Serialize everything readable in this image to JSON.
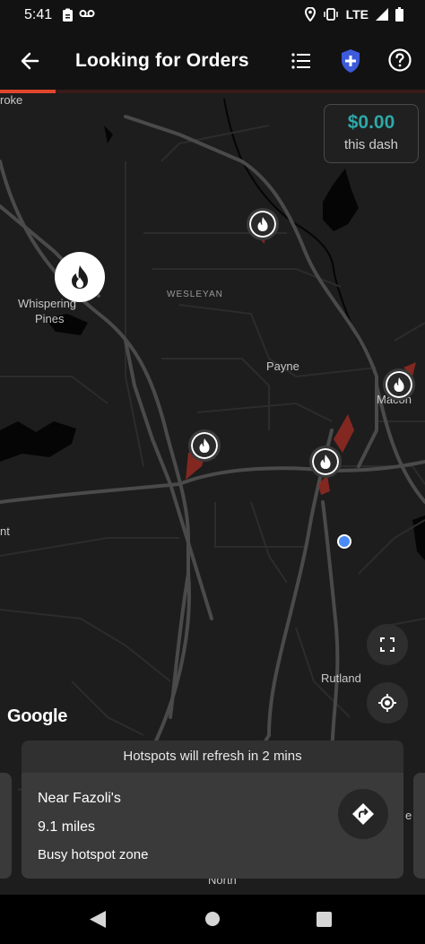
{
  "status_bar": {
    "time": "5:41",
    "network": "LTE",
    "icons": [
      "clipboard-icon",
      "voicemail-icon",
      "location-icon",
      "vibrate-icon",
      "signal-icon",
      "battery-icon"
    ]
  },
  "app_bar": {
    "title": "Looking for Orders",
    "icons": [
      "back-arrow-icon",
      "list-icon",
      "shield-plus-icon",
      "help-icon"
    ]
  },
  "search_progress": 0.13,
  "earnings": {
    "amount": "$0.00",
    "label": "this dash",
    "amount_color": "#2ea8a8"
  },
  "map": {
    "labels": {
      "broke": "roke",
      "whispering": "Whispering",
      "pines": "Pines",
      "wesleyan": "WESLEYAN",
      "payne": "Payne",
      "macon": "Macon",
      "ont": "nt",
      "rutland": "Rutland",
      "north": "North",
      "east": "e"
    },
    "attribution": "Google",
    "hotspot_icon": "flame-icon",
    "buttons": [
      "fullscreen-icon",
      "recenter-icon"
    ]
  },
  "hotspot_panel": {
    "refresh_text": "Hotspots will refresh in 2 mins",
    "location": "Near Fazoli's",
    "distance": "9.1 miles",
    "description": "Busy hotspot zone"
  },
  "colors": {
    "accent": "#e0462c",
    "user_location": "#4a8af4"
  },
  "nav_bar": {
    "icons": [
      "nav-back-icon",
      "nav-home-icon",
      "nav-recents-icon"
    ]
  }
}
